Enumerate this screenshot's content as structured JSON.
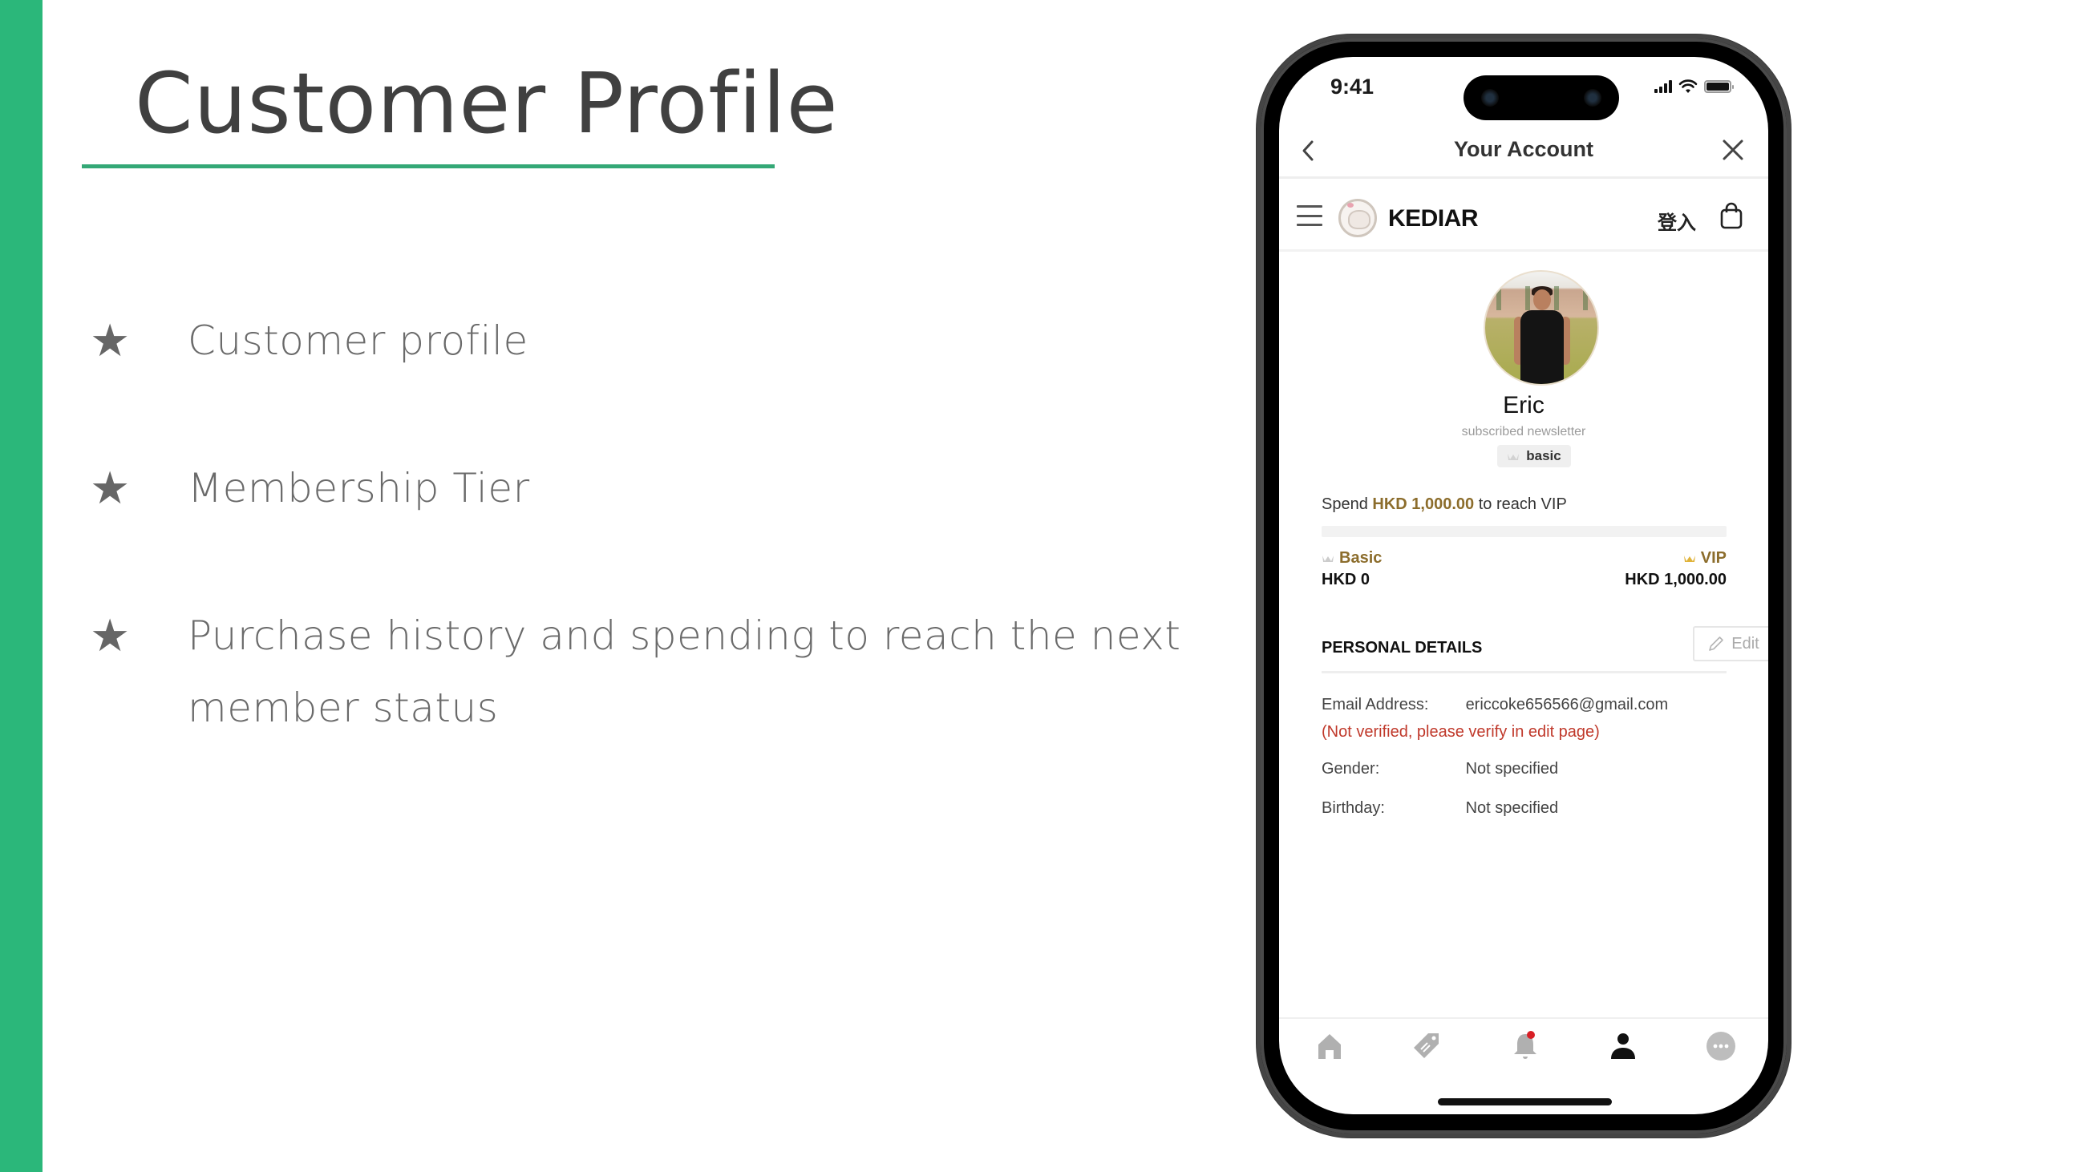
{
  "slide": {
    "title": "Customer Profile",
    "accent_color": "#2bb77a",
    "bullets": [
      {
        "icon": "star-icon",
        "text": "Customer profile"
      },
      {
        "icon": "star-icon",
        "text": "Membership Tier"
      },
      {
        "icon": "star-icon",
        "text": "Purchase history and spending to reach the next member status"
      }
    ]
  },
  "phone": {
    "status_bar": {
      "time": "9:41"
    },
    "nav_header": {
      "title": "Your Account",
      "back_icon": "chevron-left-icon",
      "close_icon": "close-icon"
    },
    "store_bar": {
      "menu_icon": "hamburger-icon",
      "store_name": "KEDIAR",
      "login_label": "登入",
      "cart_icon": "shopping-bag-icon"
    },
    "profile": {
      "name": "Eric",
      "subtitle": "subscribed newsletter",
      "tier_badge": "basic"
    },
    "membership": {
      "spend_prefix": "Spend",
      "spend_amount": "HKD 1,000.00",
      "spend_suffix": "to reach VIP",
      "progress_fraction": 0,
      "current_tier": {
        "name": "Basic",
        "amount": "HKD 0"
      },
      "next_tier": {
        "name": "VIP",
        "amount": "HKD 1,000.00"
      },
      "tier_colors": {
        "label": "#8c6d2c",
        "vip_crown": "#e0b33a",
        "basic_crown": "#cccccc"
      }
    },
    "personal_details": {
      "heading": "PERSONAL DETAILS",
      "edit_label": "Edit",
      "rows": [
        {
          "label": "Email Address:",
          "value": "ericcoke656566@gmail.com"
        },
        {
          "label": "Gender:",
          "value": "Not specified"
        },
        {
          "label": "Birthday:",
          "value": "Not specified"
        }
      ],
      "verify_note": "(Not verified, please verify in edit page)",
      "warning_color": "#c0392b"
    },
    "tab_bar": {
      "items": [
        {
          "icon": "home-icon",
          "active": false
        },
        {
          "icon": "tag-icon",
          "active": false
        },
        {
          "icon": "bell-icon",
          "active": false,
          "badge": true
        },
        {
          "icon": "user-icon",
          "active": true
        },
        {
          "icon": "more-icon",
          "active": false
        }
      ]
    }
  }
}
